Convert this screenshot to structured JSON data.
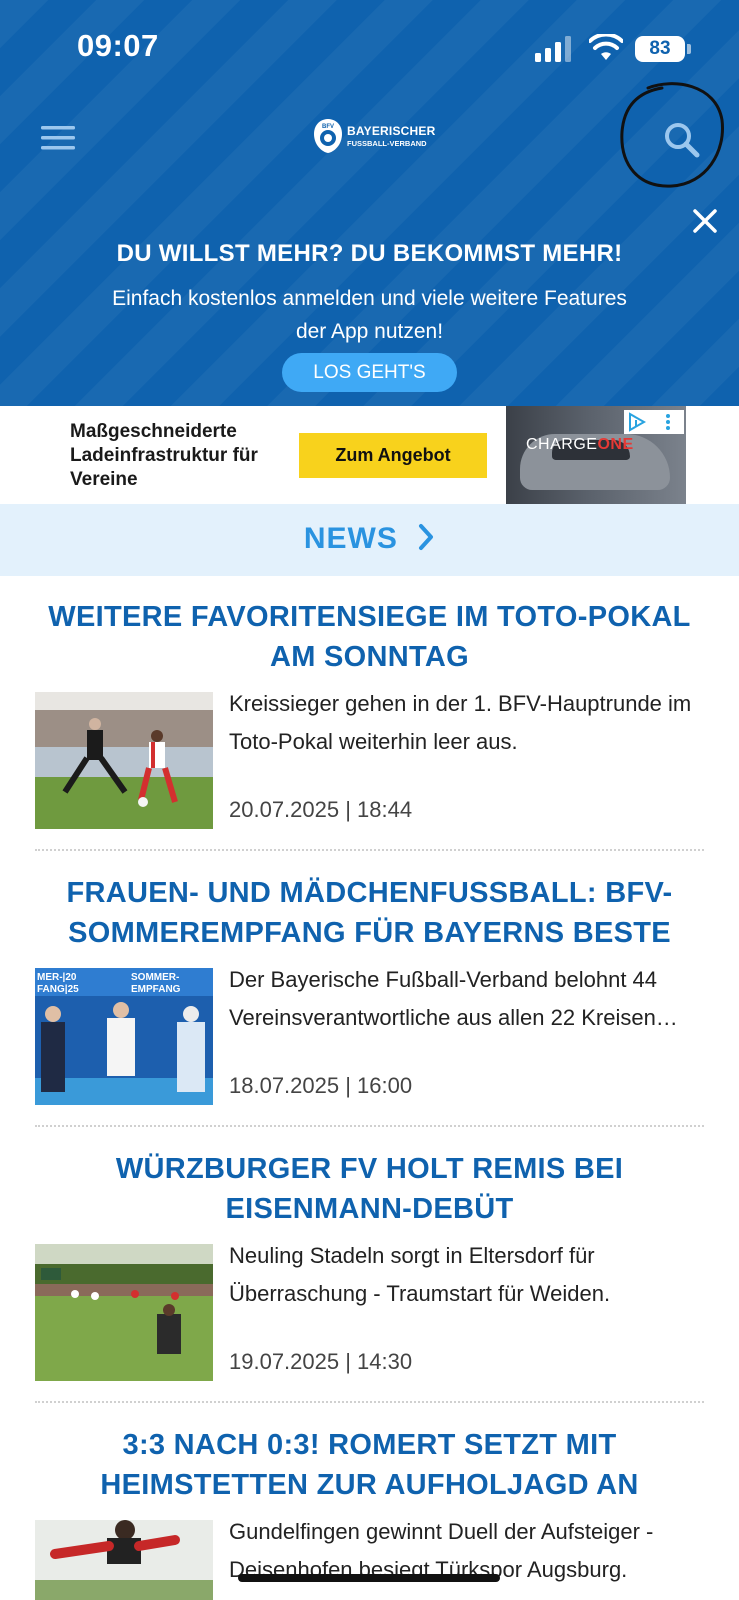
{
  "status_bar": {
    "time": "09:07",
    "battery": "83",
    "icons": [
      "signal-icon",
      "wifi-icon",
      "battery-icon"
    ]
  },
  "header": {
    "logo_line1": "BAYERISCHER",
    "logo_line2": "FUSSBALL-VERBAND",
    "logo_badge": "BFV",
    "menu_icon": "hamburger-menu-icon",
    "search_icon": "search-icon",
    "search_marked_by_hand_circle": true
  },
  "promo": {
    "title": "DU WILLST MEHR? DU BEKOMMST MEHR!",
    "body": "Einfach kostenlos anmelden und viele weitere Features der App nutzen!",
    "button": "LOS GEHT'S",
    "close_icon": "close-icon"
  },
  "ad": {
    "text": "Maßgeschneiderte Ladeinfrastruktur für Vereine",
    "cta": "Zum Angebot",
    "brand_part1": "CHARGE",
    "brand_part2": "ONE"
  },
  "news": {
    "label": "NEWS",
    "articles": [
      {
        "title": "WEITERE FAVORITENSIEGE IM TOTO-POKAL AM SONNTAG",
        "text": "Kreissieger gehen in der 1. BFV-Hauptrunde im Toto-Pokal weiterhin leer aus.",
        "date": "20.07.2025 | 18:44"
      },
      {
        "title": "FRAUEN- UND MÄDCHENFUSSBALL: BFV-SOMMEREMPFANG FÜR BAYERNS BESTE",
        "text": "Der Bayerische Fußball-Verband belohnt 44 Vereinsverantwortliche aus allen 22 Kreisen…",
        "date": "18.07.2025 | 16:00",
        "thumb_text_left": "MER-|20\nFANG|25",
        "thumb_text_right": "SOMMER-\nEMPFANG"
      },
      {
        "title": "WÜRZBURGER FV HOLT REMIS BEI EISENMANN-DEBÜT",
        "text": "Neuling Stadeln sorgt in Eltersdorf für Überraschung - Traumstart für Weiden.",
        "date": "19.07.2025 | 14:30"
      },
      {
        "title": "3:3 NACH 0:3! ROMERT SETZT MIT HEIMSTETTEN ZUR AUFHOLJAGD AN",
        "text": "Gundelfingen gewinnt Duell der Aufsteiger - Deisenhofen besiegt Türkspor Augsburg.",
        "date": ""
      }
    ]
  },
  "colors": {
    "header_blue": "#0f62ae",
    "accent_blue": "#2a93e0",
    "button_blue": "#3fa9f5",
    "news_bar_bg": "#e3f1fc",
    "ad_yellow": "#f8d21c"
  }
}
